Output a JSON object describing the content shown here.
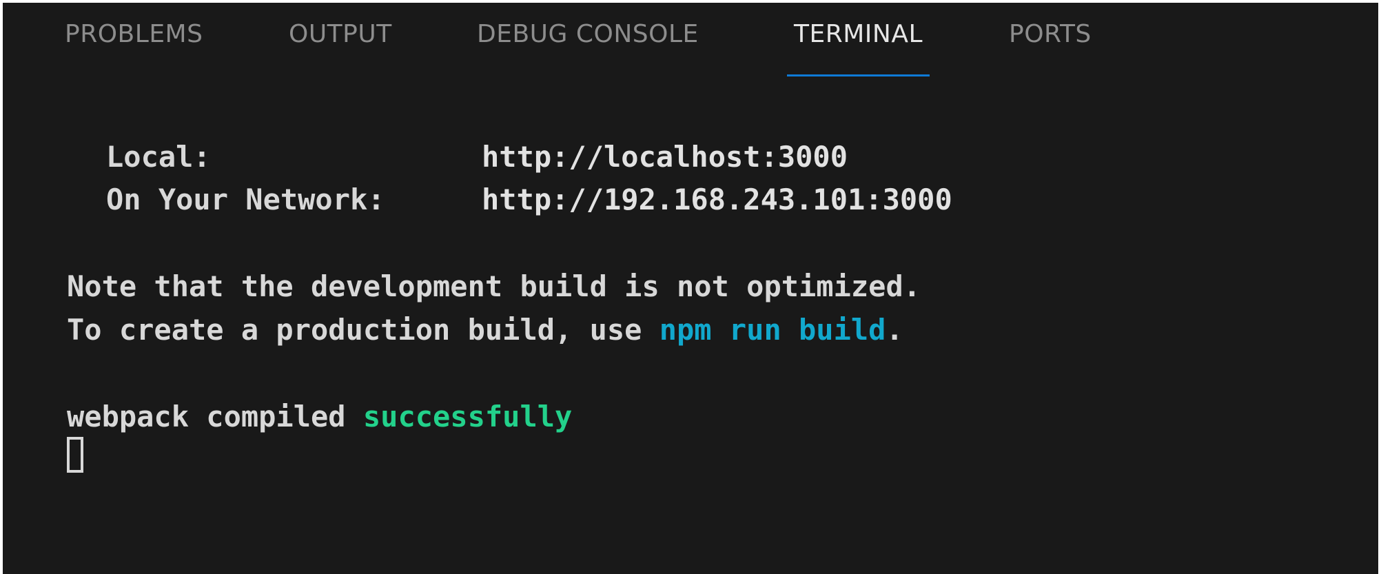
{
  "panel": {
    "tabs": [
      {
        "label": "PROBLEMS",
        "active": false
      },
      {
        "label": "OUTPUT",
        "active": false
      },
      {
        "label": "DEBUG CONSOLE",
        "active": false
      },
      {
        "label": "TERMINAL",
        "active": true
      },
      {
        "label": "PORTS",
        "active": false
      }
    ],
    "active_tab_color": "#0e7ad6"
  },
  "terminal": {
    "local_label": "Local:",
    "local_url": "http://localhost:3000",
    "network_label": "On Your Network:",
    "network_url": "http://192.168.243.101:3000",
    "note_line": "Note that the development build is not optimized.",
    "create_line_prefix": "To create a production build, use ",
    "create_line_command": "npm run build",
    "create_line_suffix": ".",
    "webpack_prefix": "webpack compiled ",
    "webpack_status": "successfully"
  },
  "colors": {
    "background": "#191919",
    "default_text": "#d8d8d8",
    "command": "#11a8cd",
    "success": "#23d18b"
  }
}
